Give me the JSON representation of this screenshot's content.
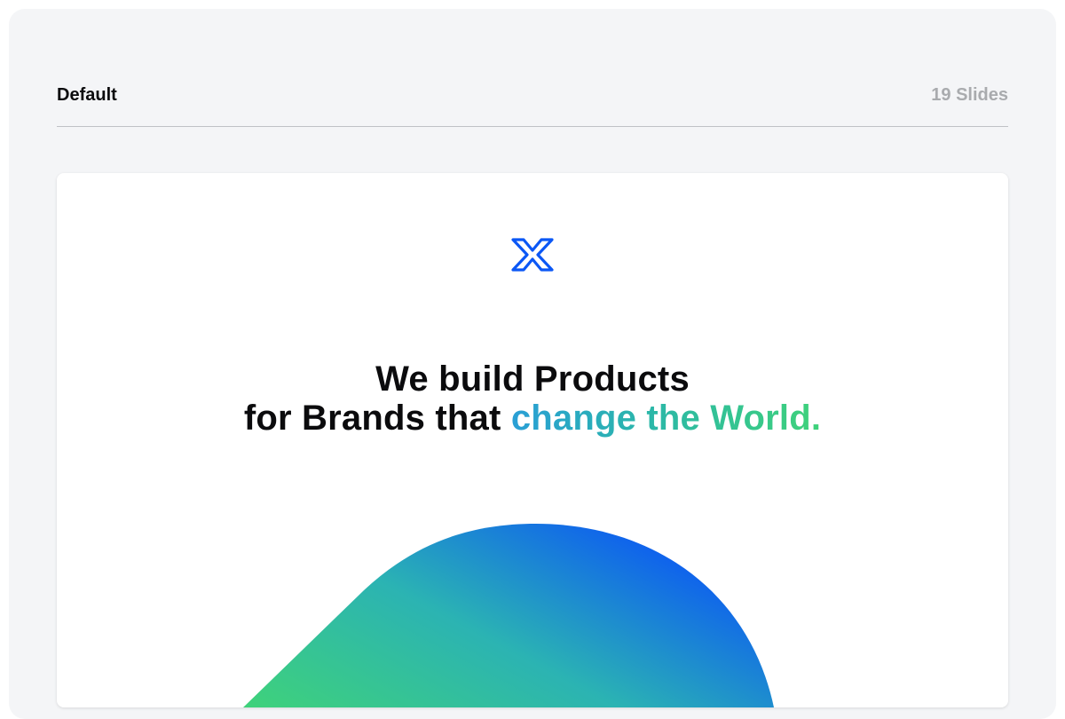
{
  "header": {
    "title": "Default",
    "slide_count": "19 Slides"
  },
  "slide": {
    "logo_icon": "x-logo-icon",
    "headline_line1": "We build Products",
    "headline_line2_prefix": "for Brands that ",
    "headline_line2_highlight": "change the World.",
    "colors": {
      "brand_blue": "#0b57f5",
      "gradient_green": "#3fd27a",
      "gradient_teal": "#2bb7a8",
      "gradient_blue": "#0b57f5"
    }
  }
}
